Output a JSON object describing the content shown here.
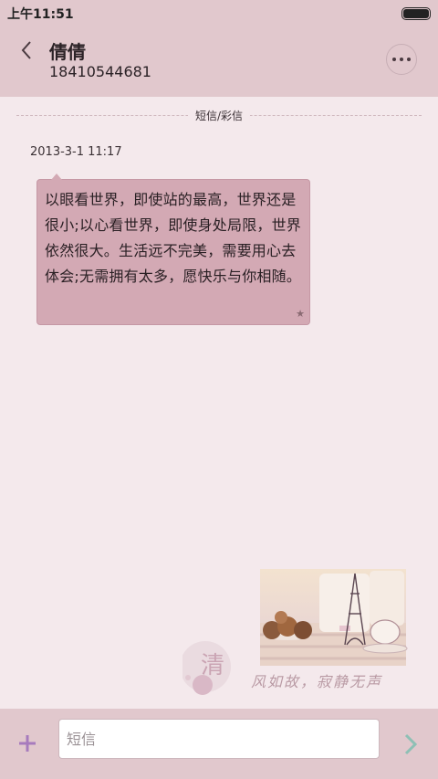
{
  "status_bar": {
    "time": "上午11:51"
  },
  "header": {
    "contact_name": "倩倩",
    "phone_number": "18410544681"
  },
  "divider_label": "短信/彩信",
  "message": {
    "timestamp": "2013-3-1 11:17",
    "text": "以眼看世界，即使站的最高，世界还是很小;以心看世界，即使身处局限，世界依然很大。生活远不完美，需要用心去体会;无需拥有太多，愿快乐与你相随。"
  },
  "background_art": {
    "character": "清",
    "caption": "风如故，寂静无声"
  },
  "composer": {
    "placeholder": "短信"
  },
  "colors": {
    "accent_plus": "#a77bbd",
    "send_arrow": "#8ec0b5",
    "header_bg": "#e1c8cd",
    "bubble_bg": "#d3a9b4"
  },
  "icons": {
    "back": "chevron-left-icon",
    "more": "more-dots-icon",
    "star": "star-icon",
    "plus": "plus-icon",
    "send": "chevron-right-icon"
  }
}
